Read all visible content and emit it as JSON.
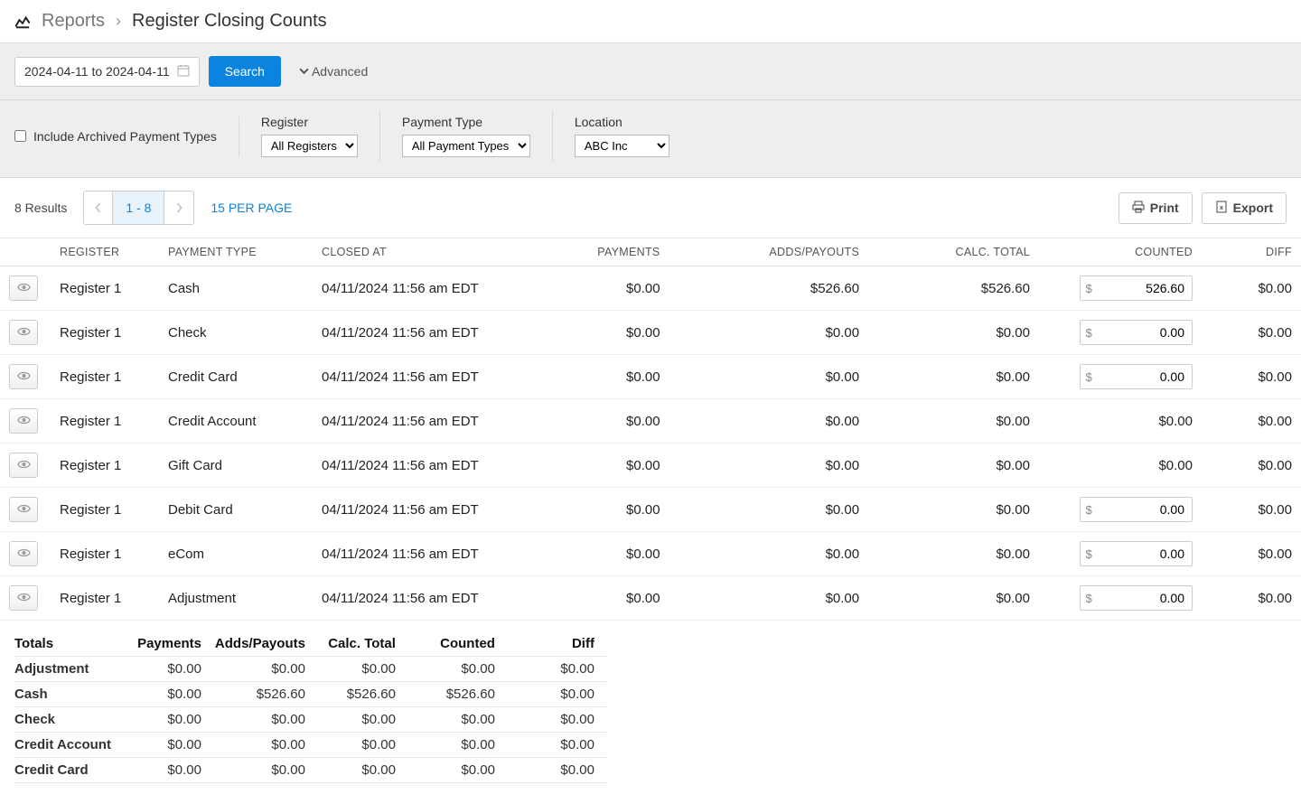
{
  "breadcrumb": {
    "link": "Reports",
    "current": "Register Closing Counts"
  },
  "searchBar": {
    "dateRange": "2024-04-11 to 2024-04-11",
    "searchLabel": "Search",
    "advancedLabel": "Advanced"
  },
  "filters": {
    "includeArchivedLabel": "Include Archived Payment Types",
    "registerLabel": "Register",
    "registerValue": "All Registers",
    "paymentTypeLabel": "Payment Type",
    "paymentTypeValue": "All Payment Types",
    "locationLabel": "Location",
    "locationValue": "ABC Inc"
  },
  "results": {
    "countLabel": "8 Results",
    "pageLabel": "1 - 8",
    "perPageLabel": "15 PER PAGE",
    "printLabel": "Print",
    "exportLabel": "Export"
  },
  "table": {
    "headers": {
      "register": "REGISTER",
      "paymentType": "PAYMENT TYPE",
      "closedAt": "CLOSED AT",
      "payments": "PAYMENTS",
      "addsPayouts": "ADDS/PAYOUTS",
      "calcTotal": "CALC. TOTAL",
      "counted": "COUNTED",
      "diff": "DIFF"
    },
    "rows": [
      {
        "register": "Register 1",
        "paymentType": "Cash",
        "closedAt": "04/11/2024 11:56 am EDT",
        "payments": "$0.00",
        "addsPayouts": "$526.60",
        "calcTotal": "$526.60",
        "countedInput": "526.60",
        "countedStatic": null,
        "diff": "$0.00"
      },
      {
        "register": "Register 1",
        "paymentType": "Check",
        "closedAt": "04/11/2024 11:56 am EDT",
        "payments": "$0.00",
        "addsPayouts": "$0.00",
        "calcTotal": "$0.00",
        "countedInput": "0.00",
        "countedStatic": null,
        "diff": "$0.00"
      },
      {
        "register": "Register 1",
        "paymentType": "Credit Card",
        "closedAt": "04/11/2024 11:56 am EDT",
        "payments": "$0.00",
        "addsPayouts": "$0.00",
        "calcTotal": "$0.00",
        "countedInput": "0.00",
        "countedStatic": null,
        "diff": "$0.00"
      },
      {
        "register": "Register 1",
        "paymentType": "Credit Account",
        "closedAt": "04/11/2024 11:56 am EDT",
        "payments": "$0.00",
        "addsPayouts": "$0.00",
        "calcTotal": "$0.00",
        "countedInput": null,
        "countedStatic": "$0.00",
        "diff": "$0.00"
      },
      {
        "register": "Register 1",
        "paymentType": "Gift Card",
        "closedAt": "04/11/2024 11:56 am EDT",
        "payments": "$0.00",
        "addsPayouts": "$0.00",
        "calcTotal": "$0.00",
        "countedInput": null,
        "countedStatic": "$0.00",
        "diff": "$0.00"
      },
      {
        "register": "Register 1",
        "paymentType": "Debit Card",
        "closedAt": "04/11/2024 11:56 am EDT",
        "payments": "$0.00",
        "addsPayouts": "$0.00",
        "calcTotal": "$0.00",
        "countedInput": "0.00",
        "countedStatic": null,
        "diff": "$0.00"
      },
      {
        "register": "Register 1",
        "paymentType": "eCom",
        "closedAt": "04/11/2024 11:56 am EDT",
        "payments": "$0.00",
        "addsPayouts": "$0.00",
        "calcTotal": "$0.00",
        "countedInput": "0.00",
        "countedStatic": null,
        "diff": "$0.00"
      },
      {
        "register": "Register 1",
        "paymentType": "Adjustment",
        "closedAt": "04/11/2024 11:56 am EDT",
        "payments": "$0.00",
        "addsPayouts": "$0.00",
        "calcTotal": "$0.00",
        "countedInput": "0.00",
        "countedStatic": null,
        "diff": "$0.00"
      }
    ]
  },
  "totals": {
    "headers": {
      "label": "Totals",
      "payments": "Payments",
      "addsPayouts": "Adds/Payouts",
      "calcTotal": "Calc. Total",
      "counted": "Counted",
      "diff": "Diff"
    },
    "rows": [
      {
        "label": "Adjustment",
        "payments": "$0.00",
        "addsPayouts": "$0.00",
        "calcTotal": "$0.00",
        "counted": "$0.00",
        "diff": "$0.00"
      },
      {
        "label": "Cash",
        "payments": "$0.00",
        "addsPayouts": "$526.60",
        "calcTotal": "$526.60",
        "counted": "$526.60",
        "diff": "$0.00"
      },
      {
        "label": "Check",
        "payments": "$0.00",
        "addsPayouts": "$0.00",
        "calcTotal": "$0.00",
        "counted": "$0.00",
        "diff": "$0.00"
      },
      {
        "label": "Credit Account",
        "payments": "$0.00",
        "addsPayouts": "$0.00",
        "calcTotal": "$0.00",
        "counted": "$0.00",
        "diff": "$0.00"
      },
      {
        "label": "Credit Card",
        "payments": "$0.00",
        "addsPayouts": "$0.00",
        "calcTotal": "$0.00",
        "counted": "$0.00",
        "diff": "$0.00"
      }
    ]
  }
}
